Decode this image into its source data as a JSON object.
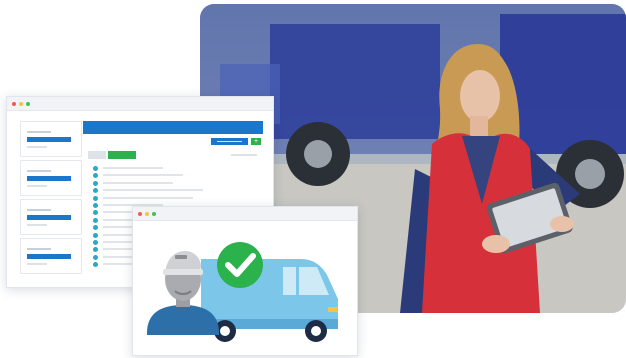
{
  "colors": {
    "brand_blue": "#1a77c9",
    "success_green": "#2bb24c",
    "accent_teal": "#2aa7c9",
    "window_dot_red": "#f2594f",
    "window_dot_yellow": "#f6c343",
    "window_dot_green": "#3fc15b",
    "van_body": "#7cc6ea",
    "driver_shirt": "#2d6fa8",
    "vest_red": "#d6313a"
  },
  "icons": {
    "hero": "woman-holding-tablet-photo",
    "dashboard_add": "plus-icon",
    "status": "checkmark-icon",
    "vehicle": "delivery-van-illustration",
    "driver": "driver-avatar-illustration"
  },
  "dashboard": {
    "add_button_label": "+",
    "sidebar_cards": 4,
    "list_rows": 14
  }
}
